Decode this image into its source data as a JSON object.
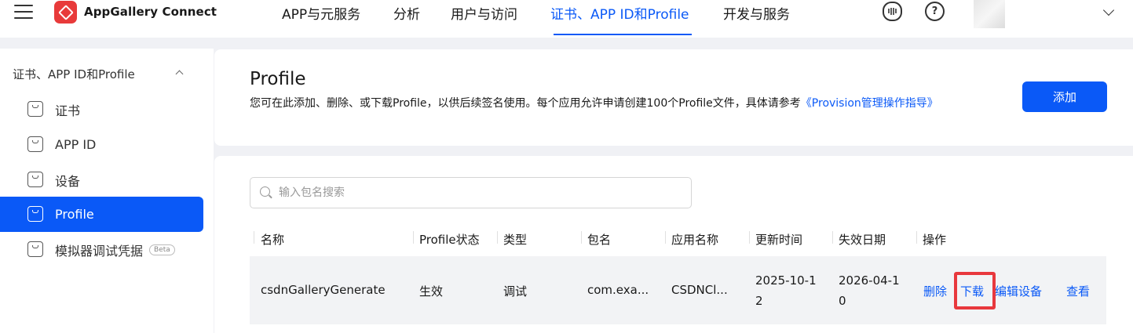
{
  "header": {
    "brand": "AppGallery Connect",
    "nav": [
      "APP与元服务",
      "分析",
      "用户与访问",
      "证书、APP ID和Profile",
      "开发与服务"
    ],
    "help_icon_glyph": "?"
  },
  "sidebar": {
    "group": "证书、APP ID和Profile",
    "items": [
      {
        "label": "证书"
      },
      {
        "label": "APP ID"
      },
      {
        "label": "设备"
      },
      {
        "label": "Profile"
      },
      {
        "label": "模拟器调试凭据",
        "badge": "Beta"
      }
    ]
  },
  "page": {
    "title": "Profile",
    "desc_text": "您可在此添加、删除、或下载Profile，以供后续签名使用。每个应用允许申请创建100个Profile文件，具体请参考",
    "desc_link": "《Provision管理操作指导》",
    "add_button": "添加"
  },
  "search": {
    "placeholder": "输入包名搜索"
  },
  "table": {
    "columns": [
      "名称",
      "Profile状态",
      "类型",
      "包名",
      "应用名称",
      "更新时间",
      "失效日期",
      "操作"
    ],
    "rows": [
      {
        "name": "csdnGalleryGenerate",
        "status": "生效",
        "type": "调试",
        "package": "com.exa...",
        "app_name": "CSDNCl...",
        "updated": "2025-10-12",
        "expires": "2026-04-10",
        "actions": [
          "删除",
          "下载",
          "编辑设备",
          "查看"
        ]
      }
    ]
  },
  "colors": {
    "accent": "#0a59f7",
    "highlight": "#e8383d"
  }
}
